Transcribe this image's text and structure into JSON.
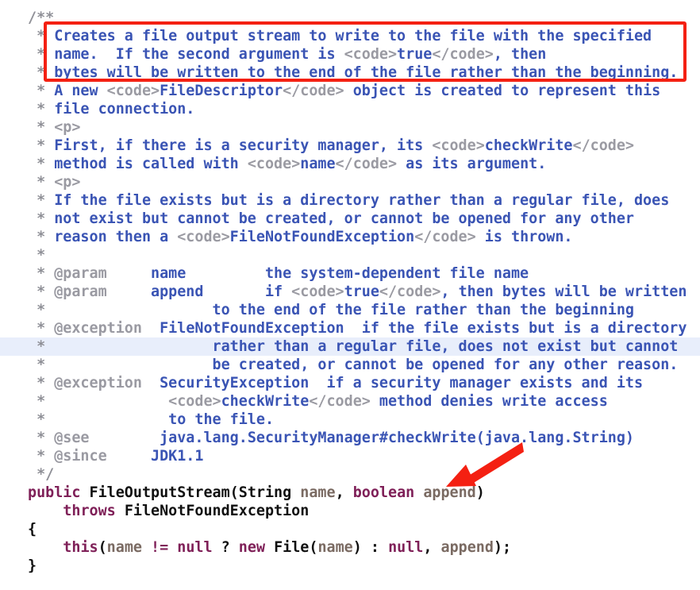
{
  "editor": {
    "language": "Java",
    "background": "#ffffff",
    "highlighted_line_index": 18,
    "highlight_color": "#e8eefb",
    "colors": {
      "javadoc_text": "#3a54b4",
      "javadoc_marker": "#8f9097",
      "javadoc_tag": "#9a9aa2",
      "html_tag": "#9a9aa2",
      "keyword": "#7f2058",
      "identifier": "#101010",
      "parameter": "#7a6a62",
      "annotation_red": "#f42012"
    }
  },
  "annotations": {
    "red_box": {
      "name": "red-rectangle-highlight",
      "color": "#f42012",
      "covers_lines": "Creates a file output stream to write to the file with the specified name.  If the second argument is <code>true</code>, then bytes will be written to the end of the file rather than the beginning."
    },
    "red_arrow": {
      "name": "red-arrow-pointer",
      "color": "#f42012",
      "points_to": "append"
    }
  },
  "code_lines": [
    {
      "id": 0,
      "tokens": [
        {
          "c": "docmark",
          "t": "/**"
        }
      ]
    },
    {
      "id": 1,
      "tokens": [
        {
          "c": "docmark",
          "t": " * "
        },
        {
          "c": "doc",
          "t": "Creates a file output stream to write to the file with the specified"
        }
      ]
    },
    {
      "id": 2,
      "tokens": [
        {
          "c": "docmark",
          "t": " * "
        },
        {
          "c": "doc",
          "t": "name.  If the second argument is "
        },
        {
          "c": "html",
          "t": "<code>"
        },
        {
          "c": "doc",
          "t": "true"
        },
        {
          "c": "html",
          "t": "</code>"
        },
        {
          "c": "doc",
          "t": ", then"
        }
      ]
    },
    {
      "id": 3,
      "tokens": [
        {
          "c": "docmark",
          "t": " * "
        },
        {
          "c": "doc",
          "t": "bytes will be written to the end of the file rather than the beginning."
        }
      ]
    },
    {
      "id": 4,
      "tokens": [
        {
          "c": "docmark",
          "t": " * "
        },
        {
          "c": "doc",
          "t": "A new "
        },
        {
          "c": "html",
          "t": "<code>"
        },
        {
          "c": "doc",
          "t": "FileDescriptor"
        },
        {
          "c": "html",
          "t": "</code>"
        },
        {
          "c": "doc",
          "t": " object is created to represent this"
        }
      ]
    },
    {
      "id": 5,
      "tokens": [
        {
          "c": "docmark",
          "t": " * "
        },
        {
          "c": "doc",
          "t": "file connection."
        }
      ]
    },
    {
      "id": 6,
      "tokens": [
        {
          "c": "docmark",
          "t": " * "
        },
        {
          "c": "html",
          "t": "<p>"
        }
      ]
    },
    {
      "id": 7,
      "tokens": [
        {
          "c": "docmark",
          "t": " * "
        },
        {
          "c": "doc",
          "t": "First, if there is a security manager, its "
        },
        {
          "c": "html",
          "t": "<code>"
        },
        {
          "c": "doc",
          "t": "checkWrite"
        },
        {
          "c": "html",
          "t": "</code>"
        }
      ]
    },
    {
      "id": 8,
      "tokens": [
        {
          "c": "docmark",
          "t": " * "
        },
        {
          "c": "doc",
          "t": "method is called with "
        },
        {
          "c": "html",
          "t": "<code>"
        },
        {
          "c": "doc",
          "t": "name"
        },
        {
          "c": "html",
          "t": "</code>"
        },
        {
          "c": "doc",
          "t": " as its argument."
        }
      ]
    },
    {
      "id": 9,
      "tokens": [
        {
          "c": "docmark",
          "t": " * "
        },
        {
          "c": "html",
          "t": "<p>"
        }
      ]
    },
    {
      "id": 10,
      "tokens": [
        {
          "c": "docmark",
          "t": " * "
        },
        {
          "c": "doc",
          "t": "If the file exists but is a directory rather than a regular file, does"
        }
      ]
    },
    {
      "id": 11,
      "tokens": [
        {
          "c": "docmark",
          "t": " * "
        },
        {
          "c": "doc",
          "t": "not exist but cannot be created, or cannot be opened for any other"
        }
      ]
    },
    {
      "id": 12,
      "tokens": [
        {
          "c": "docmark",
          "t": " * "
        },
        {
          "c": "doc",
          "t": "reason then a "
        },
        {
          "c": "html",
          "t": "<code>"
        },
        {
          "c": "doc",
          "t": "FileNotFoundException"
        },
        {
          "c": "html",
          "t": "</code>"
        },
        {
          "c": "doc",
          "t": " is thrown."
        }
      ]
    },
    {
      "id": 13,
      "tokens": [
        {
          "c": "docmark",
          "t": " *"
        }
      ]
    },
    {
      "id": 14,
      "tokens": [
        {
          "c": "docmark",
          "t": " * "
        },
        {
          "c": "tag",
          "t": "@param"
        },
        {
          "c": "doc",
          "t": "     name         the system-dependent file name"
        }
      ]
    },
    {
      "id": 15,
      "tokens": [
        {
          "c": "docmark",
          "t": " * "
        },
        {
          "c": "tag",
          "t": "@param"
        },
        {
          "c": "doc",
          "t": "     append       if "
        },
        {
          "c": "html",
          "t": "<code>"
        },
        {
          "c": "doc",
          "t": "true"
        },
        {
          "c": "html",
          "t": "</code>"
        },
        {
          "c": "doc",
          "t": ", then bytes will be written"
        }
      ]
    },
    {
      "id": 16,
      "tokens": [
        {
          "c": "docmark",
          "t": " * "
        },
        {
          "c": "doc",
          "t": "                  to the end of the file rather than the beginning"
        }
      ]
    },
    {
      "id": 17,
      "tokens": [
        {
          "c": "docmark",
          "t": " * "
        },
        {
          "c": "tag",
          "t": "@exception"
        },
        {
          "c": "doc",
          "t": "  FileNotFoundException  if the file exists but is a directory"
        }
      ]
    },
    {
      "id": 18,
      "tokens": [
        {
          "c": "docmark",
          "t": " * "
        },
        {
          "c": "doc",
          "t": "                  rather than a regular file, does not exist but cannot"
        }
      ]
    },
    {
      "id": 19,
      "tokens": [
        {
          "c": "docmark",
          "t": " * "
        },
        {
          "c": "doc",
          "t": "                  be created, or cannot be opened for any other reason."
        }
      ]
    },
    {
      "id": 20,
      "tokens": [
        {
          "c": "docmark",
          "t": " * "
        },
        {
          "c": "tag",
          "t": "@exception"
        },
        {
          "c": "doc",
          "t": "  SecurityException  if a security manager exists and its"
        }
      ]
    },
    {
      "id": 21,
      "tokens": [
        {
          "c": "docmark",
          "t": " * "
        },
        {
          "c": "doc",
          "t": "             "
        },
        {
          "c": "html",
          "t": "<code>"
        },
        {
          "c": "doc",
          "t": "checkWrite"
        },
        {
          "c": "html",
          "t": "</code>"
        },
        {
          "c": "doc",
          "t": " method denies write access"
        }
      ]
    },
    {
      "id": 22,
      "tokens": [
        {
          "c": "docmark",
          "t": " * "
        },
        {
          "c": "doc",
          "t": "             to the file."
        }
      ]
    },
    {
      "id": 23,
      "tokens": [
        {
          "c": "docmark",
          "t": " * "
        },
        {
          "c": "tag",
          "t": "@see"
        },
        {
          "c": "doc",
          "t": "        java.lang.SecurityManager#checkWrite(java.lang.String)"
        }
      ]
    },
    {
      "id": 24,
      "tokens": [
        {
          "c": "docmark",
          "t": " * "
        },
        {
          "c": "tag",
          "t": "@since"
        },
        {
          "c": "doc",
          "t": "     JDK1.1"
        }
      ]
    },
    {
      "id": 25,
      "tokens": [
        {
          "c": "docmark",
          "t": " */"
        }
      ]
    },
    {
      "id": 26,
      "tokens": [
        {
          "c": "kw",
          "t": "public"
        },
        {
          "c": "punct",
          "t": " "
        },
        {
          "c": "id",
          "t": "FileOutputStream"
        },
        {
          "c": "punct",
          "t": "("
        },
        {
          "c": "id",
          "t": "String"
        },
        {
          "c": "punct",
          "t": " "
        },
        {
          "c": "param",
          "t": "name"
        },
        {
          "c": "punct",
          "t": ", "
        },
        {
          "c": "kw",
          "t": "boolean"
        },
        {
          "c": "punct",
          "t": " "
        },
        {
          "c": "param",
          "t": "append"
        },
        {
          "c": "punct",
          "t": ")"
        }
      ]
    },
    {
      "id": 27,
      "tokens": [
        {
          "c": "punct",
          "t": "    "
        },
        {
          "c": "kw",
          "t": "throws"
        },
        {
          "c": "punct",
          "t": " "
        },
        {
          "c": "id",
          "t": "FileNotFoundException"
        }
      ]
    },
    {
      "id": 28,
      "tokens": [
        {
          "c": "punct",
          "t": "{"
        }
      ]
    },
    {
      "id": 29,
      "tokens": [
        {
          "c": "punct",
          "t": "    "
        },
        {
          "c": "kw",
          "t": "this"
        },
        {
          "c": "punct",
          "t": "("
        },
        {
          "c": "param",
          "t": "name"
        },
        {
          "c": "punct",
          "t": " "
        },
        {
          "c": "kw",
          "t": "!="
        },
        {
          "c": "punct",
          "t": " "
        },
        {
          "c": "kw",
          "t": "null"
        },
        {
          "c": "punct",
          "t": " ? "
        },
        {
          "c": "kw",
          "t": "new"
        },
        {
          "c": "punct",
          "t": " "
        },
        {
          "c": "id",
          "t": "File"
        },
        {
          "c": "punct",
          "t": "("
        },
        {
          "c": "param",
          "t": "name"
        },
        {
          "c": "punct",
          "t": ") : "
        },
        {
          "c": "kw",
          "t": "null"
        },
        {
          "c": "punct",
          "t": ", "
        },
        {
          "c": "param",
          "t": "append"
        },
        {
          "c": "punct",
          "t": ");"
        }
      ]
    },
    {
      "id": 30,
      "tokens": [
        {
          "c": "punct",
          "t": "}"
        }
      ]
    }
  ]
}
